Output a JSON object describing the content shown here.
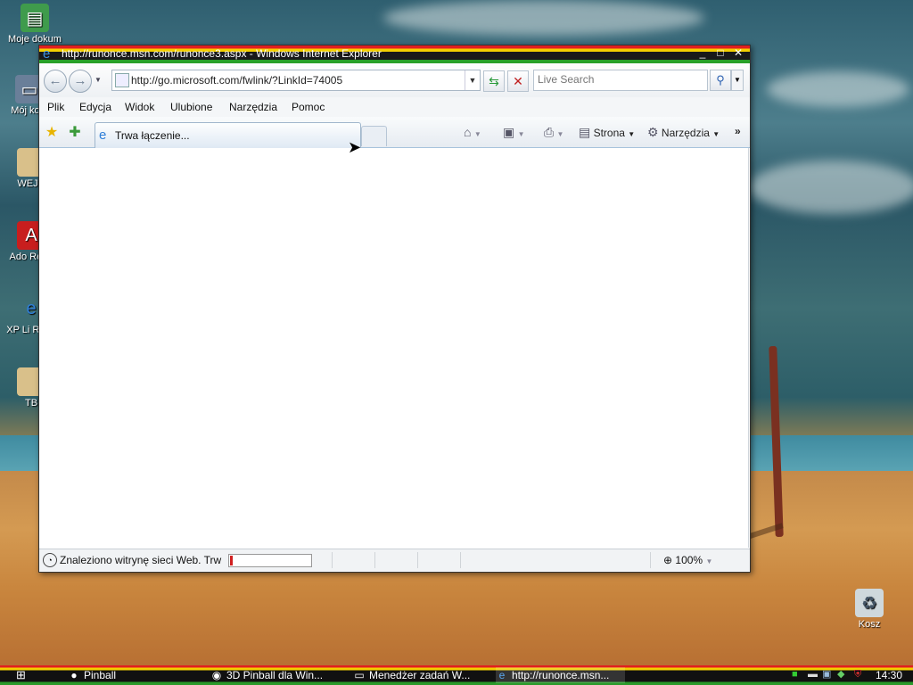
{
  "desktop": {
    "icons": [
      {
        "label": "Moje dokum",
        "icon": "folder-documents-icon"
      },
      {
        "label": "Mój kom",
        "icon": "computer-icon"
      },
      {
        "label": "WEJD",
        "icon": "folder-icon"
      },
      {
        "label": "Ado Read",
        "icon": "adobe-reader-icon"
      },
      {
        "label": "XP Li Read",
        "icon": "ie-icon"
      },
      {
        "label": "TB",
        "icon": "folder-icon"
      },
      {
        "label": "Kosz",
        "icon": "recycle-bin-icon"
      }
    ]
  },
  "window": {
    "title": "http://runonce.msn.com/runonce3.aspx - Windows Internet Explorer",
    "controls": {
      "minimize": "_",
      "maximize": "□",
      "close": "✕"
    },
    "address_url": "http://go.microsoft.com/fwlink/?LinkId=74005",
    "search_placeholder": "Live Search",
    "menu": [
      "Plik",
      "Edycja",
      "Widok",
      "Ulubione",
      "Narzędzia",
      "Pomoc"
    ],
    "tab_title": "Trwa łączenie...",
    "toolbar": {
      "page_label": "Strona",
      "tools_label": "Narzędzia",
      "more": "»"
    },
    "status_text": "Znaleziono witrynę sieci Web. Trw",
    "progress_percent": 3,
    "zoom": "100%"
  },
  "taskbar": {
    "tasks": [
      {
        "label": "Pinball",
        "icon": "pinball-icon"
      },
      {
        "label": "3D Pinball dla Win...",
        "icon": "pinball-3d-icon"
      },
      {
        "label": "Menedżer zadań W...",
        "icon": "task-manager-icon"
      },
      {
        "label": "http://runonce.msn...",
        "icon": "ie-icon"
      }
    ],
    "clock": "14:30"
  },
  "colors": {
    "stripe_red": "#e02020",
    "stripe_yellow": "#f4d000",
    "stripe_green": "#28a028",
    "progress": "#d02020"
  }
}
